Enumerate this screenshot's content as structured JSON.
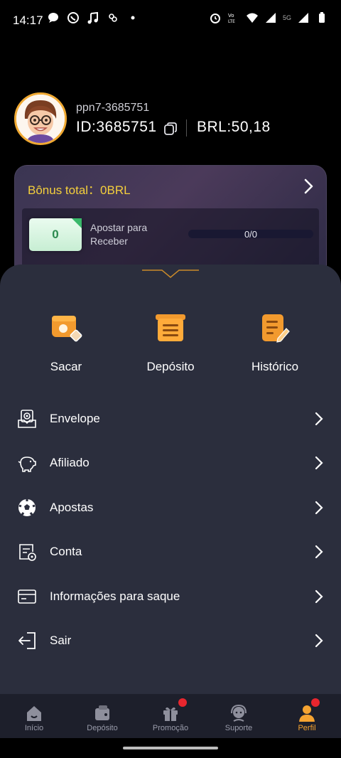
{
  "status_bar": {
    "time": "14:17",
    "network": "5G"
  },
  "profile": {
    "username": "ppn7-3685751",
    "id_text": "ID:3685751",
    "balance_text": "BRL:50,18"
  },
  "bonus": {
    "title": "Bônus total：0BRL",
    "ticket_value": "0",
    "bet_text": "Apostar para Receber",
    "progress_text": "0/0",
    "progress_fraction": 0
  },
  "actions": [
    {
      "label": "Sacar",
      "icon": "withdraw-icon"
    },
    {
      "label": "Depósito",
      "icon": "deposit-icon"
    },
    {
      "label": "Histórico",
      "icon": "history-icon"
    }
  ],
  "menu": [
    {
      "label": "Envelope",
      "icon": "envelope-icon"
    },
    {
      "label": "Afiliado",
      "icon": "piggy-bank-icon"
    },
    {
      "label": "Apostas",
      "icon": "soccer-ball-icon"
    },
    {
      "label": "Conta",
      "icon": "account-statement-icon"
    },
    {
      "label": "Informações para saque",
      "icon": "card-icon"
    },
    {
      "label": "Sair",
      "icon": "logout-icon"
    }
  ],
  "bottom_nav": [
    {
      "label": "Início",
      "icon": "home-icon",
      "active": false,
      "badge": false
    },
    {
      "label": "Depósito",
      "icon": "wallet-icon",
      "active": false,
      "badge": false
    },
    {
      "label": "Promoção",
      "icon": "gift-icon",
      "active": false,
      "badge": true
    },
    {
      "label": "Suporte",
      "icon": "support-icon",
      "active": false,
      "badge": false
    },
    {
      "label": "Perfil",
      "icon": "profile-icon",
      "active": true,
      "badge": true
    }
  ],
  "colors": {
    "accent": "#f5a331",
    "bonus_title": "#f4cf3c",
    "badge": "#e8262e",
    "panel": "#2b2e3d"
  }
}
